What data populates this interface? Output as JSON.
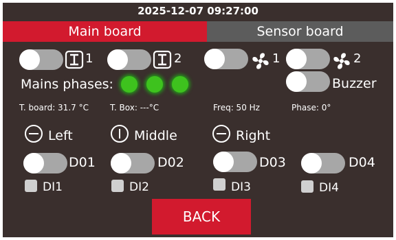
{
  "header": {
    "datetime": "2025-12-07 09:27:00"
  },
  "tabs": [
    {
      "label": "Main board",
      "active": true
    },
    {
      "label": "Sensor board",
      "active": false
    }
  ],
  "outputs": [
    {
      "icon": "line-output-icon",
      "num": "1"
    },
    {
      "icon": "line-output-icon",
      "num": "2"
    },
    {
      "icon": "fan-icon",
      "num": "1"
    },
    {
      "icon": "fan-icon",
      "num": "2"
    }
  ],
  "buzzer_label": "Buzzer",
  "mains_label": "Mains phases:",
  "status": {
    "t_board": "T. board: 31.7 °C",
    "t_box": "T. Box: ---°C",
    "freq": "Freq: 50 Hz",
    "phase": "Phase: 0°"
  },
  "position": {
    "left": "Left",
    "middle": "Middle",
    "right": "Right"
  },
  "digital_outputs": [
    "D01",
    "D02",
    "D03",
    "D04"
  ],
  "digital_inputs": [
    "DI1",
    "DI2",
    "DI3",
    "DI4"
  ],
  "back_label": "BACK",
  "colors": {
    "background": "#3a2f2d",
    "accent_red": "#d21a2e",
    "indicator_green": "#3ec21e",
    "toggle_off": "#a7a7a7"
  }
}
